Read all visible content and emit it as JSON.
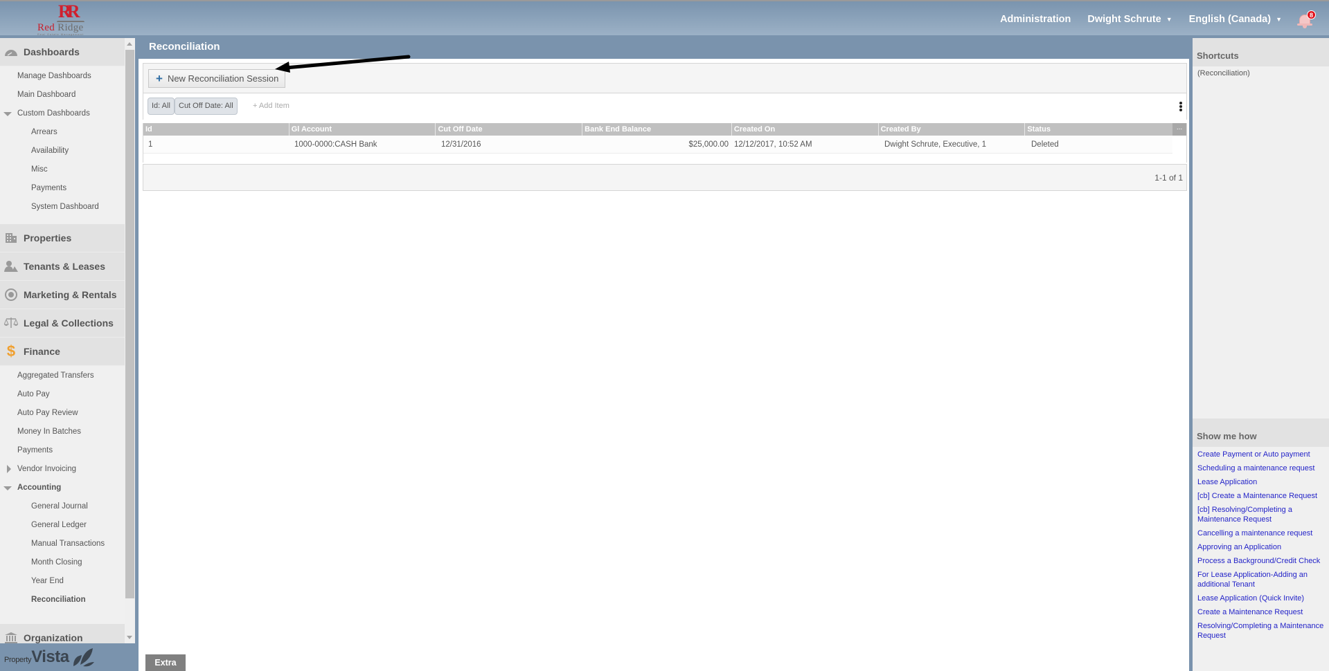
{
  "header": {
    "logo": {
      "initials": "RR",
      "name_red": "Red",
      "name_gray": "Ridge",
      "tagline": "Real Estate Management"
    },
    "nav": {
      "administration": "Administration",
      "user": "Dwight Schrute",
      "language": "English (Canada)",
      "notifications_count": "8"
    }
  },
  "sidebar": {
    "sections": [
      {
        "label": "Dashboards",
        "icon": "dashboard-icon",
        "items": [
          {
            "label": "Manage Dashboards",
            "level": 1
          },
          {
            "label": "Main Dashboard",
            "level": 1
          },
          {
            "label": "Custom Dashboards",
            "level": 1,
            "expanded": true
          },
          {
            "label": "Arrears",
            "level": 2
          },
          {
            "label": "Availability",
            "level": 2
          },
          {
            "label": "Misc",
            "level": 2
          },
          {
            "label": "Payments",
            "level": 2
          },
          {
            "label": "System Dashboard",
            "level": 2
          }
        ]
      },
      {
        "label": "Properties",
        "icon": "building-icon"
      },
      {
        "label": "Tenants & Leases",
        "icon": "people-icon"
      },
      {
        "label": "Marketing & Rentals",
        "icon": "target-icon"
      },
      {
        "label": "Legal & Collections",
        "icon": "scales-icon"
      },
      {
        "label": "Finance",
        "icon": "dollar-icon",
        "items": [
          {
            "label": "Aggregated Transfers",
            "level": 1
          },
          {
            "label": "Auto Pay",
            "level": 1
          },
          {
            "label": "Auto Pay Review",
            "level": 1
          },
          {
            "label": "Money In Batches",
            "level": 1
          },
          {
            "label": "Payments",
            "level": 1
          },
          {
            "label": "Vendor Invoicing",
            "level": 1,
            "expanded": false
          },
          {
            "label": "Accounting",
            "level": 1,
            "expanded": true
          },
          {
            "label": "General Journal",
            "level": 2
          },
          {
            "label": "General Ledger",
            "level": 2
          },
          {
            "label": "Manual Transactions",
            "level": 2
          },
          {
            "label": "Month Closing",
            "level": 2
          },
          {
            "label": "Year End",
            "level": 2
          },
          {
            "label": "Reconciliation",
            "level": 2,
            "active": true
          }
        ]
      },
      {
        "label": "Organization",
        "icon": "bank-icon"
      }
    ],
    "footer": {
      "brand_small": "Property",
      "brand_big": "Vista"
    }
  },
  "main": {
    "title": "Reconciliation",
    "toolbar": {
      "new_button": "New Reconciliation Session"
    },
    "filters": [
      "Id: All",
      "Cut Off Date: All"
    ],
    "add_item": "+ Add Item",
    "table": {
      "columns": [
        "Id",
        "Gl Account",
        "Cut Off Date",
        "Bank End Balance",
        "Created On",
        "Created By",
        "Status"
      ],
      "more": "...",
      "rows": [
        [
          "1",
          "1000-0000:CASH Bank",
          "12/31/2016",
          "$25,000.00",
          "12/12/2017, 10:52 AM",
          "Dwight Schrute, Executive, 1",
          "Deleted"
        ]
      ]
    },
    "pagination": "1-1 of 1",
    "extra_button": "Extra"
  },
  "right_panel": {
    "shortcuts": {
      "title": "Shortcuts",
      "text": "(Reconciliation)"
    },
    "show_me_how": {
      "title": "Show me how",
      "links": [
        "Create Payment or Auto payment",
        "Scheduling a maintenance request",
        "Lease Application",
        "[cb] Create a Maintenance Request",
        "[cb] Resolving/Completing a Maintenance Request",
        "Cancelling a maintenance request",
        "Approving an Application",
        "Process a Background/Credit Check",
        "For Lease Application-Adding an additional Tenant",
        "Lease Application (Quick Invite)",
        "Create a Maintenance Request",
        "Resolving/Completing a Maintenance Request"
      ]
    }
  },
  "colors": {
    "header_top": "#7a94ae",
    "header_bottom": "#9cb1c6",
    "frame": "#7a93ad",
    "link": "#2323c8",
    "table_header": "#c0c0c0",
    "notification_badge": "#e0101a",
    "logo_red": "#c8202d"
  }
}
